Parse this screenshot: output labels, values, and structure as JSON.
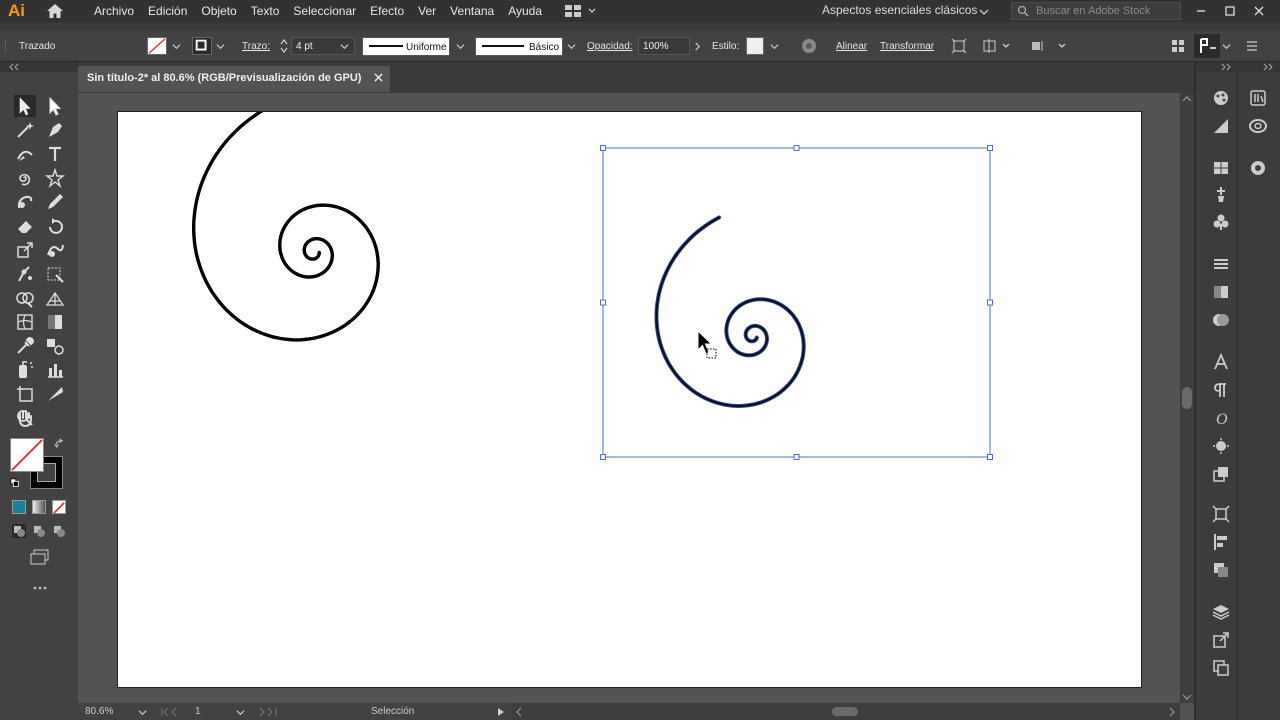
{
  "app": {
    "logo": "Ai"
  },
  "menu": {
    "items": [
      "Archivo",
      "Edición",
      "Objeto",
      "Texto",
      "Seleccionar",
      "Efecto",
      "Ver",
      "Ventana",
      "Ayuda"
    ],
    "workspace": "Aspectos esenciales clásicos",
    "search_placeholder": "Buscar en Adobe Stock"
  },
  "control": {
    "object_type": "Trazado",
    "stroke_label": "Trazo:",
    "stroke_weight": "4 pt",
    "profile": "Uniforme",
    "brush": "Básico",
    "opacity_label": "Opacidad:",
    "opacity": "100%",
    "style_label": "Estilo:",
    "align": "Alinear",
    "transform": "Transformar"
  },
  "document": {
    "tab_title": "Sin título-2* al 80.6% (RGB/Previsualización de GPU)"
  },
  "status": {
    "zoom": "80.6%",
    "artboard": "1",
    "tool": "Selección"
  },
  "colors": {
    "accent": "#1473e6",
    "selection": "#4a6fd1",
    "chrome": "#323232",
    "panel": "#424242"
  }
}
